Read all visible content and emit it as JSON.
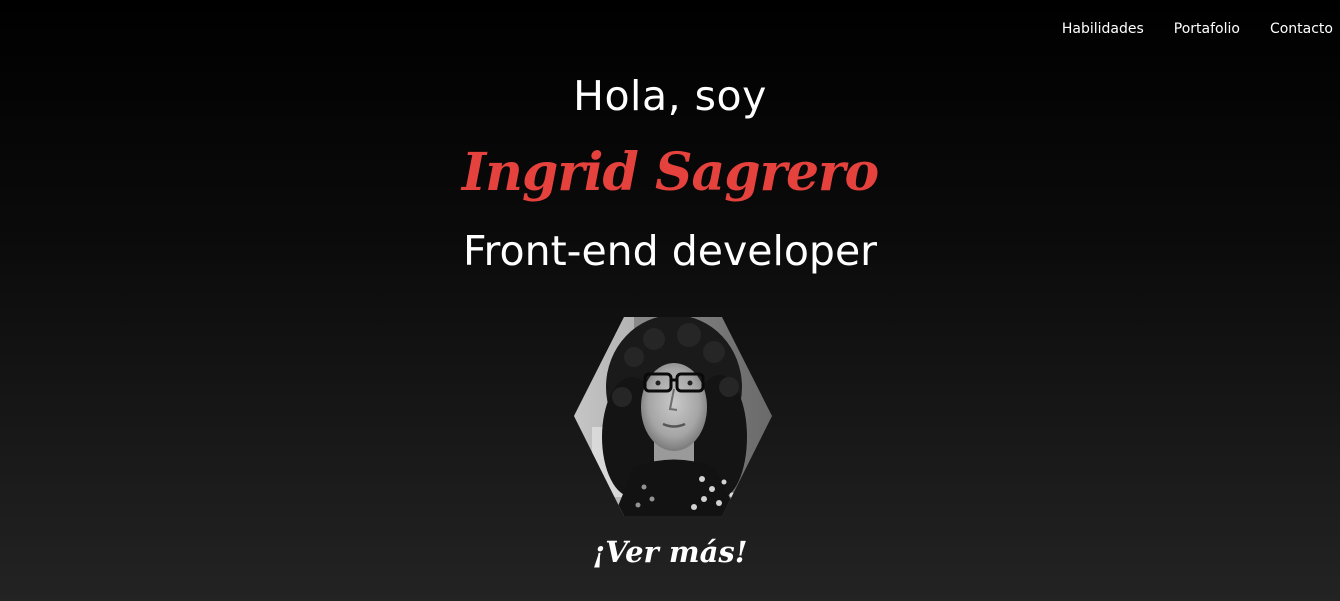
{
  "nav": {
    "items": [
      {
        "label": "Habilidades"
      },
      {
        "label": "Portafolio"
      },
      {
        "label": "Contacto"
      }
    ]
  },
  "hero": {
    "greeting": "Hola, soy",
    "name": "Ingrid Sagrero",
    "role": "Front-end developer",
    "cta": "¡Ver más!"
  },
  "colors": {
    "accent": "#e5413d",
    "text": "#ffffff",
    "background_top": "#000000",
    "background_bottom": "#232323"
  }
}
